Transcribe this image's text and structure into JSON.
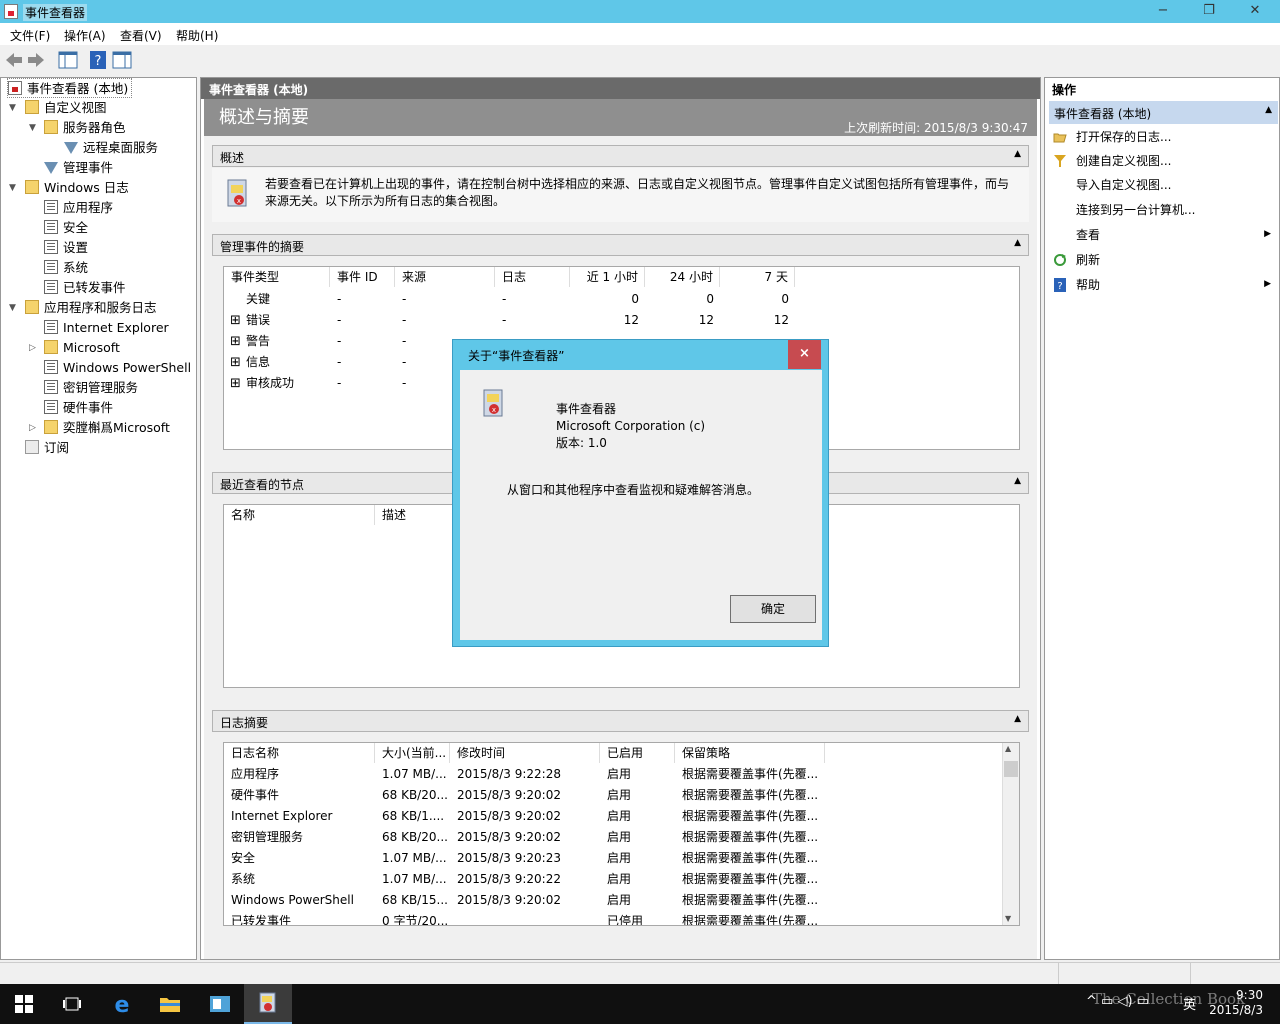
{
  "window": {
    "title": "事件查看器",
    "min": "−",
    "max": "❐",
    "close": "✕"
  },
  "menu": [
    "文件(F)",
    "操作(A)",
    "查看(V)",
    "帮助(H)"
  ],
  "tree": {
    "root": "事件查看器 (本地)",
    "custom_views": "自定义视图",
    "server_roles": "服务器角色",
    "rds": "远程桌面服务",
    "admin_events": "管理事件",
    "windows_logs": "Windows 日志",
    "application": "应用程序",
    "security": "安全",
    "setup": "设置",
    "system": "系统",
    "forwarded": "已转发事件",
    "app_service_logs": "应用程序和服务日志",
    "ie": "Internet Explorer",
    "microsoft": "Microsoft",
    "powershell": "Windows PowerShell",
    "key_mgmt": "密钥管理服务",
    "hardware": "硬件事件",
    "garbled": "奕膛槲爲Microsoft",
    "subscriptions": "订阅"
  },
  "center": {
    "header": "事件查看器 (本地)",
    "overview_title": "概述与摘要",
    "last_refresh": "上次刷新时间: 2015/8/3 9:30:47",
    "sec_overview": "概述",
    "overview_text_1": "若要查看已在计算机上出现的事件，请在控制台树中选择相应的来源、日志或自定义视图节点。管理事件自定义试图包括所有管理事件，而与",
    "overview_text_2": "来源无关。以下所示为所有日志的集合视图。",
    "sec_admin": "管理事件的摘要",
    "admin_cols": [
      "事件类型",
      "事件 ID",
      "来源",
      "日志",
      "近 1 小时",
      "24 小时",
      "7 天"
    ],
    "admin_rows": [
      {
        "type": "关键",
        "id": "-",
        "src": "-",
        "log": "-",
        "h1": "0",
        "h24": "0",
        "d7": "0",
        "exp": ""
      },
      {
        "type": "错误",
        "id": "-",
        "src": "-",
        "log": "-",
        "h1": "12",
        "h24": "12",
        "d7": "12",
        "exp": "⊞"
      },
      {
        "type": "警告",
        "id": "-",
        "src": "-",
        "log": "",
        "h1": "",
        "h24": "",
        "d7": "",
        "exp": "⊞"
      },
      {
        "type": "信息",
        "id": "-",
        "src": "-",
        "log": "",
        "h1": "",
        "h24": "",
        "d7": "",
        "exp": "⊞"
      },
      {
        "type": "审核成功",
        "id": "-",
        "src": "-",
        "log": "",
        "h1": "",
        "h24": "",
        "d7": "",
        "exp": "⊞"
      }
    ],
    "sec_recent": "最近查看的节点",
    "recent_cols": [
      "名称",
      "描述"
    ],
    "sec_logsum": "日志摘要",
    "log_cols": [
      "日志名称",
      "大小(当前...",
      "修改时间",
      "已启用",
      "保留策略"
    ],
    "log_rows": [
      {
        "name": "应用程序",
        "size": "1.07 MB/...",
        "time": "2015/8/3 9:22:28",
        "en": "启用",
        "policy": "根据需要覆盖事件(先覆..."
      },
      {
        "name": "硬件事件",
        "size": "68 KB/20...",
        "time": "2015/8/3 9:20:02",
        "en": "启用",
        "policy": "根据需要覆盖事件(先覆..."
      },
      {
        "name": "Internet Explorer",
        "size": "68 KB/1....",
        "time": "2015/8/3 9:20:02",
        "en": "启用",
        "policy": "根据需要覆盖事件(先覆..."
      },
      {
        "name": "密钥管理服务",
        "size": "68 KB/20...",
        "time": "2015/8/3 9:20:02",
        "en": "启用",
        "policy": "根据需要覆盖事件(先覆..."
      },
      {
        "name": "安全",
        "size": "1.07 MB/...",
        "time": "2015/8/3 9:20:23",
        "en": "启用",
        "policy": "根据需要覆盖事件(先覆..."
      },
      {
        "name": "系统",
        "size": "1.07 MB/...",
        "time": "2015/8/3 9:20:22",
        "en": "启用",
        "policy": "根据需要覆盖事件(先覆..."
      },
      {
        "name": "Windows PowerShell",
        "size": "68 KB/15...",
        "time": "2015/8/3 9:20:02",
        "en": "启用",
        "policy": "根据需要覆盖事件(先覆..."
      },
      {
        "name": "已转发事件",
        "size": "0 字节/20...",
        "time": "",
        "en": "已停用",
        "policy": "根据需要覆盖事件(先覆..."
      }
    ]
  },
  "actions": {
    "title": "操作",
    "sub": "事件查看器 (本地)",
    "items": [
      "打开保存的日志...",
      "创建自定义视图...",
      "导入自定义视图...",
      "连接到另一台计算机...",
      "查看",
      "刷新",
      "帮助"
    ]
  },
  "dialog": {
    "title": "关于“事件查看器”",
    "close": "×",
    "product": "事件查看器",
    "company": "Microsoft Corporation (c)",
    "version": "版本: 1.0",
    "desc": "从窗口和其他程序中查看监视和疑难解答消息。",
    "ok": "确定"
  },
  "taskbar": {
    "time": "9:30",
    "date": "2015/8/3",
    "ime": "英"
  },
  "watermark": "The Collection Book"
}
